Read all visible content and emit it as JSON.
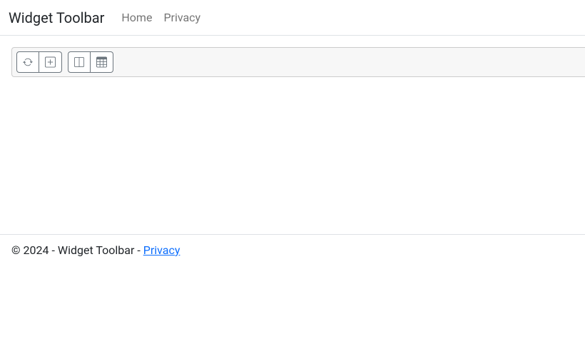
{
  "nav": {
    "brand": "Widget Toolbar",
    "links": [
      {
        "label": "Home"
      },
      {
        "label": "Privacy"
      }
    ]
  },
  "toolbar": {
    "group1": [
      {
        "icon": "refresh-icon"
      },
      {
        "icon": "plus-square-icon"
      }
    ],
    "group2": [
      {
        "icon": "columns-icon"
      },
      {
        "icon": "table-icon"
      }
    ]
  },
  "footer": {
    "copyright": "© 2024 - Widget Toolbar - ",
    "privacy_label": "Privacy"
  }
}
